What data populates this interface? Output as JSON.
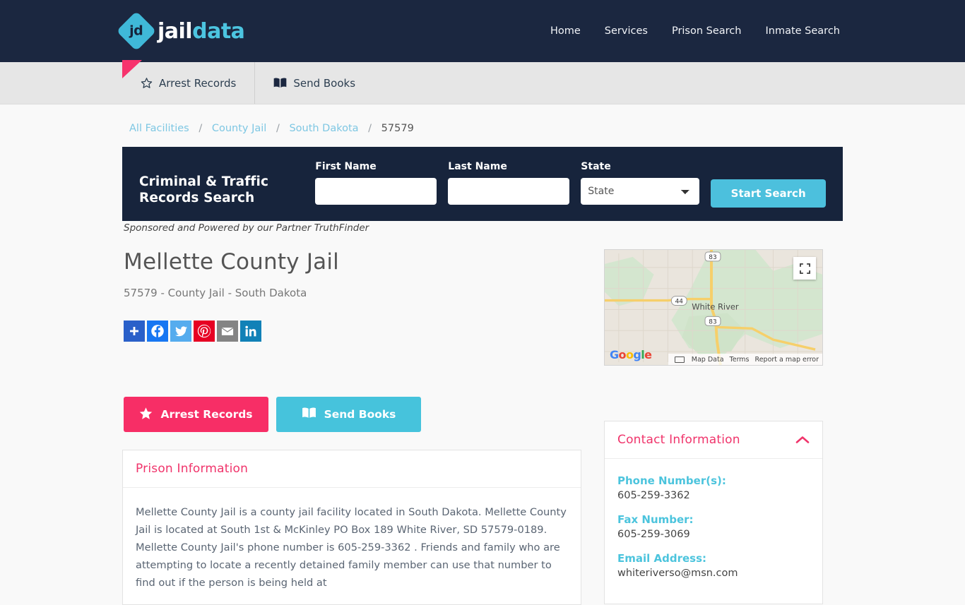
{
  "header": {
    "logo_mark_text": "jd",
    "logo_word_1": "jail",
    "logo_word_2": "data",
    "nav": [
      {
        "label": "Home"
      },
      {
        "label": "Services"
      },
      {
        "label": "Prison Search"
      },
      {
        "label": "Inmate Search"
      }
    ]
  },
  "tabstrip": {
    "tabs": [
      {
        "label": "Arrest Records",
        "icon": "star-icon"
      },
      {
        "label": "Send Books",
        "icon": "open-book-icon"
      }
    ]
  },
  "breadcrumb": {
    "items": [
      {
        "label": "All Facilities",
        "link": true
      },
      {
        "label": "County Jail",
        "link": true
      },
      {
        "label": "South Dakota",
        "link": true
      },
      {
        "label": "57579",
        "link": false
      }
    ],
    "separator": "/"
  },
  "search_panel": {
    "title": "Criminal & Traffic Records Search",
    "first_name_label": "First Name",
    "first_name_value": "",
    "first_name_placeholder": "",
    "last_name_label": "Last Name",
    "last_name_value": "",
    "last_name_placeholder": "",
    "state_label": "State",
    "state_selected": "State",
    "state_options": [
      "State"
    ],
    "submit_label": "Start Search",
    "accent_color": "#4cc0dd",
    "background_color": "#17243c"
  },
  "sponsor_note": "Sponsored and Powered by our Partner TruthFinder",
  "facility": {
    "title": "Mellette County Jail",
    "subtitle": "57579 - County Jail - South Dakota"
  },
  "share": {
    "buttons": [
      {
        "name": "addthis-icon",
        "label": "Share",
        "color": "#2a60c9"
      },
      {
        "name": "facebook-icon",
        "label": "Facebook",
        "color": "#1877f2"
      },
      {
        "name": "twitter-icon",
        "label": "Twitter",
        "color": "#55acee"
      },
      {
        "name": "pinterest-icon",
        "label": "Pinterest",
        "color": "#e60023"
      },
      {
        "name": "email-icon",
        "label": "Email",
        "color": "#848484"
      },
      {
        "name": "linkedin-icon",
        "label": "LinkedIn",
        "color": "#1181b7"
      }
    ]
  },
  "map": {
    "city_label": "White River",
    "route_labels": [
      "83",
      "44",
      "83"
    ],
    "provider_logo": "Google",
    "attribution": {
      "map_data": "Map Data",
      "terms": "Terms",
      "report": "Report a map error"
    },
    "fullscreen_icon": "fullscreen-icon"
  },
  "actions": {
    "arrest_records_label": "Arrest Records",
    "arrest_records_color": "#f72e66",
    "send_books_label": "Send Books",
    "send_books_color": "#46c3dc"
  },
  "prison_info": {
    "heading": "Prison Information",
    "body": "Mellette County Jail is a county jail facility located in South Dakota. Mellette County Jail is located at South 1st & McKinley PO Box 189 White River, SD 57579-0189. Mellette County Jail's phone number is 605-259-3362 . Friends and family who are attempting to locate a recently detained family member can use that number to find out if the person is being held at"
  },
  "contact_info": {
    "heading": "Contact Information",
    "collapse_icon": "chevron-up-icon",
    "fields": [
      {
        "label": "Phone Number(s):",
        "value": "605-259-3362"
      },
      {
        "label": "Fax Number:",
        "value": "605-259-3069"
      },
      {
        "label": "Email Address:",
        "value": "whiteriverso@msn.com"
      }
    ]
  }
}
